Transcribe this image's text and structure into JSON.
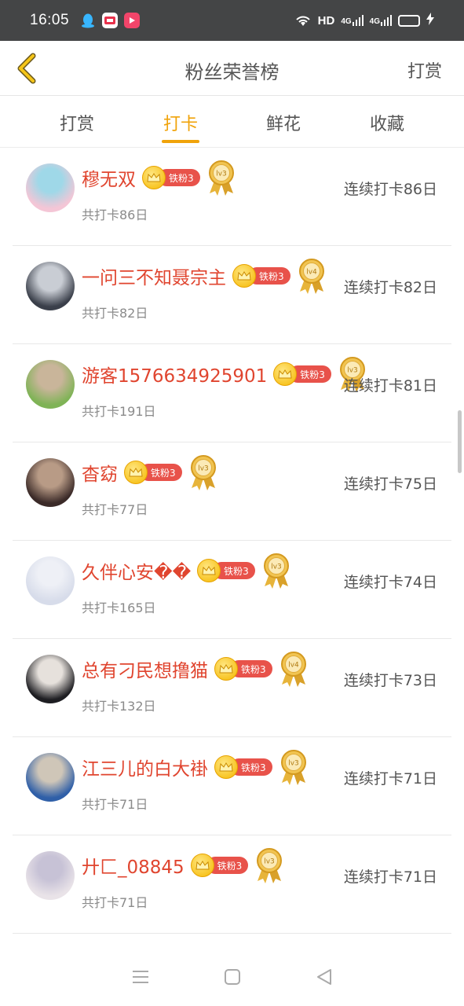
{
  "status_bar": {
    "time": "16:05",
    "network": "HD",
    "sim1": "4G",
    "sim2": "4G",
    "battery_level": 0.45,
    "battery_color": "#f5c518"
  },
  "header": {
    "back_icon": "chevron-left-icon",
    "title": "粉丝荣誉榜",
    "action_label": "打赏"
  },
  "tabs": [
    {
      "label": "打赏",
      "active": false
    },
    {
      "label": "打卡",
      "active": true
    },
    {
      "label": "鲜花",
      "active": false
    },
    {
      "label": "收藏",
      "active": false
    }
  ],
  "accent_color": "#f0a30a",
  "name_color": "#e0452f",
  "fans": [
    {
      "name": "穆无双",
      "badge": "铁粉3",
      "level": "lv3",
      "total": "共打卡86日",
      "streak": "连续打卡86日"
    },
    {
      "name": "一问三不知聂宗主",
      "badge": "铁粉3",
      "level": "lv4",
      "total": "共打卡82日",
      "streak": "连续打卡82日"
    },
    {
      "name": "游客1576634925901",
      "badge": "铁粉3",
      "level": "lv3",
      "total": "共打卡191日",
      "streak": "连续打卡81日"
    },
    {
      "name": "杳窈",
      "badge": "铁粉3",
      "level": "lv3",
      "total": "共打卡77日",
      "streak": "连续打卡75日"
    },
    {
      "name": "久伴心安��",
      "badge": "铁粉3",
      "level": "lv3",
      "total": "共打卡165日",
      "streak": "连续打卡74日"
    },
    {
      "name": "总有刁民想撸猫",
      "badge": "铁粉3",
      "level": "lv4",
      "total": "共打卡132日",
      "streak": "连续打卡73日"
    },
    {
      "name": "江三儿的白大褂",
      "badge": "铁粉3",
      "level": "lv3",
      "total": "共打卡71日",
      "streak": "连续打卡71日"
    },
    {
      "name": "廾匚_08845",
      "badge": "铁粉3",
      "level": "lv3",
      "total": "共打卡71日",
      "streak": "连续打卡71日"
    }
  ],
  "system_nav": {
    "menu_icon": "menu-icon",
    "home_icon": "home-square-icon",
    "back_icon": "back-triangle-icon"
  }
}
